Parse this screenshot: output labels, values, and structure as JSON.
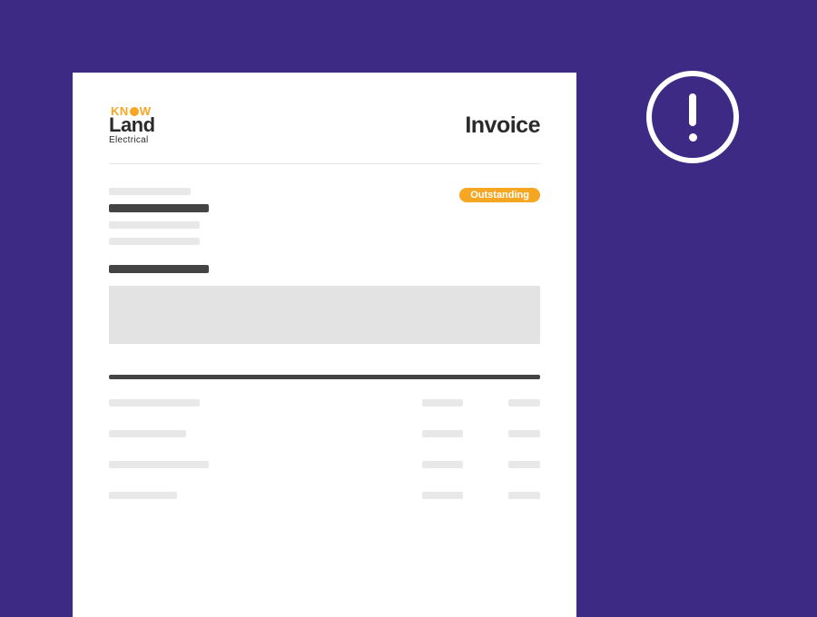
{
  "logo": {
    "top": "KNOW",
    "main": "Land",
    "sub": "Electrical"
  },
  "document": {
    "title": "Invoice",
    "status": "Outstanding"
  },
  "colors": {
    "background": "#3c2a85",
    "accent": "#f5a623",
    "text_dark": "#2a2a2a"
  }
}
